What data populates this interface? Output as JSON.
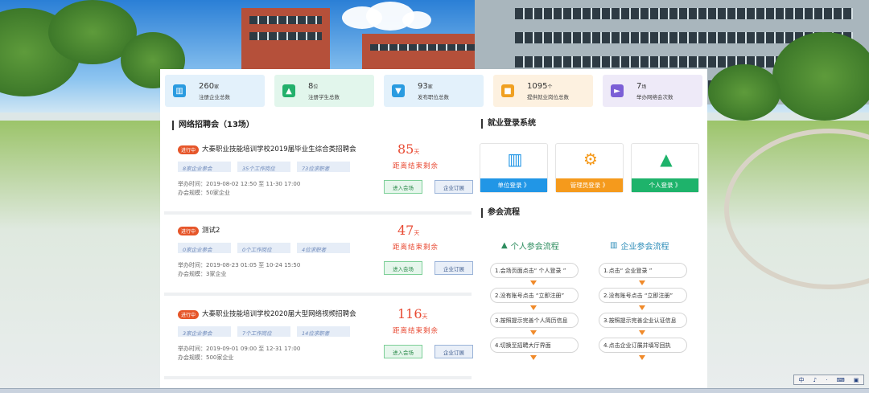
{
  "stats": [
    {
      "num": "260",
      "unit": "家",
      "label": "注册企业总数",
      "icon": "building-icon",
      "bg": "#e3f1fb",
      "color": "#2a9be0"
    },
    {
      "num": "8",
      "unit": "位",
      "label": "注册学生总数",
      "icon": "graduation-cap-icon",
      "bg": "#e2f6ec",
      "color": "#23b06b"
    },
    {
      "num": "93",
      "unit": "家",
      "label": "发布职位总数",
      "icon": "tie-icon",
      "bg": "#e3f1fb",
      "color": "#2a9be0"
    },
    {
      "num": "1095",
      "unit": "个",
      "label": "提供就业岗位总数",
      "icon": "briefcase-icon",
      "bg": "#fdf1e0",
      "color": "#f0a021"
    },
    {
      "num": "7",
      "unit": "场",
      "label": "举办网络会次数",
      "icon": "video-icon",
      "bg": "#eeeaf8",
      "color": "#7b5fd6"
    }
  ],
  "fairs_title": "网络招聘会（13场）",
  "fairs": [
    {
      "badge": "进行中",
      "title": "大秦职业技能培训学校2019届毕业生综合类招聘会",
      "tags": [
        "8家企业参会",
        "35个工作岗位",
        "73位求职者"
      ],
      "time": "举办时间：2019-08-02 12:50 至 11-30 17:00",
      "scale": "办会规模：50家企业",
      "days": "85",
      "days_unit": "天",
      "countdown": "距离结束剩余",
      "enter": "进入会场",
      "subscribe": "企业订展"
    },
    {
      "badge": "进行中",
      "title": "测试2",
      "tags": [
        "0家企业参会",
        "0个工作岗位",
        "4位求职者"
      ],
      "time": "举办时间：2019-08-23 01:05 至 10-24 15:50",
      "scale": "办会规模：3家企业",
      "days": "47",
      "days_unit": "天",
      "countdown": "距离结束剩余",
      "enter": "进入会场",
      "subscribe": "企业订展"
    },
    {
      "badge": "进行中",
      "title": "大秦职业技能培训学校2020届大型网络视频招聘会",
      "tags": [
        "3家企业参会",
        "7个工作岗位",
        "14位求职者"
      ],
      "time": "举办时间：2019-09-01 09:00 至 12-31 17:00",
      "scale": "办会规模：500家企业",
      "days": "116",
      "days_unit": "天",
      "countdown": "距离结束剩余",
      "enter": "进入会场",
      "subscribe": "企业订展"
    }
  ],
  "login_title": "就业登录系统",
  "logins": [
    {
      "label": "单位登录 》",
      "icon": "company-building-icon",
      "color": "#2196e6"
    },
    {
      "label": "管理员登录 》",
      "icon": "admin-user-icon",
      "color": "#f59a1c"
    },
    {
      "label": "个人登录 》",
      "icon": "graduation-cap-icon",
      "color": "#1eb36b"
    }
  ],
  "process_title": "参会流程",
  "personal_flow": {
    "title": "个人参会流程",
    "steps": [
      "1.会场页面点击“ 个人登录 ”",
      "2.没有账号点击 “立即注册”",
      "3.按照提示完善个人简历信息",
      "4.切换至招聘大厅界面"
    ]
  },
  "company_flow": {
    "title": "企业参会流程",
    "steps": [
      "1.点击“ 企业登录 ”",
      "2.没有账号点击 “立即注册”",
      "3.按照提示完善企业认证信息",
      "4.点击企业订展并填写回执"
    ]
  },
  "tray": [
    "中",
    "♪",
    "·",
    "⌨",
    "▣"
  ]
}
